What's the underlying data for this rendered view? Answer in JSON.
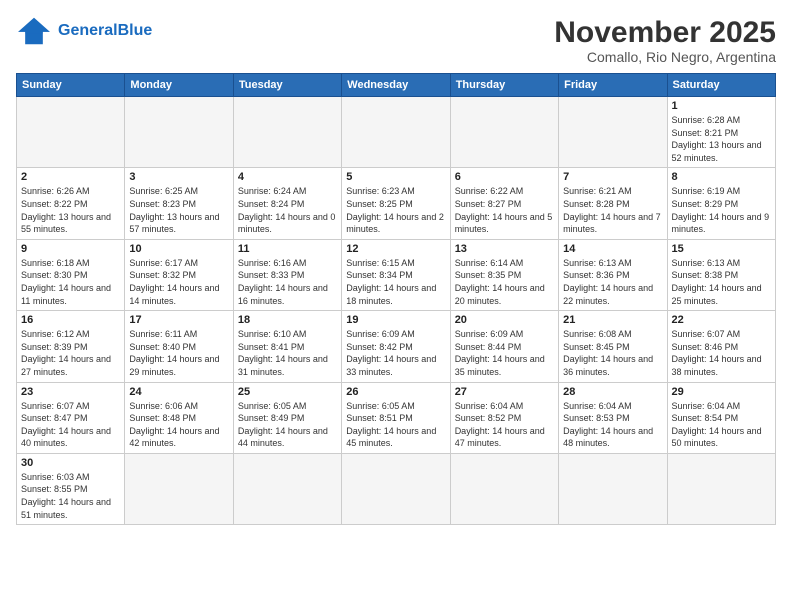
{
  "header": {
    "logo_general": "General",
    "logo_blue": "Blue",
    "title": "November 2025",
    "subtitle": "Comallo, Rio Negro, Argentina"
  },
  "days_of_week": [
    "Sunday",
    "Monday",
    "Tuesday",
    "Wednesday",
    "Thursday",
    "Friday",
    "Saturday"
  ],
  "weeks": [
    [
      {
        "day": "",
        "info": ""
      },
      {
        "day": "",
        "info": ""
      },
      {
        "day": "",
        "info": ""
      },
      {
        "day": "",
        "info": ""
      },
      {
        "day": "",
        "info": ""
      },
      {
        "day": "",
        "info": ""
      },
      {
        "day": "1",
        "info": "Sunrise: 6:28 AM\nSunset: 8:21 PM\nDaylight: 13 hours\nand 52 minutes."
      }
    ],
    [
      {
        "day": "2",
        "info": "Sunrise: 6:26 AM\nSunset: 8:22 PM\nDaylight: 13 hours\nand 55 minutes."
      },
      {
        "day": "3",
        "info": "Sunrise: 6:25 AM\nSunset: 8:23 PM\nDaylight: 13 hours\nand 57 minutes."
      },
      {
        "day": "4",
        "info": "Sunrise: 6:24 AM\nSunset: 8:24 PM\nDaylight: 14 hours\nand 0 minutes."
      },
      {
        "day": "5",
        "info": "Sunrise: 6:23 AM\nSunset: 8:25 PM\nDaylight: 14 hours\nand 2 minutes."
      },
      {
        "day": "6",
        "info": "Sunrise: 6:22 AM\nSunset: 8:27 PM\nDaylight: 14 hours\nand 5 minutes."
      },
      {
        "day": "7",
        "info": "Sunrise: 6:21 AM\nSunset: 8:28 PM\nDaylight: 14 hours\nand 7 minutes."
      },
      {
        "day": "8",
        "info": "Sunrise: 6:19 AM\nSunset: 8:29 PM\nDaylight: 14 hours\nand 9 minutes."
      }
    ],
    [
      {
        "day": "9",
        "info": "Sunrise: 6:18 AM\nSunset: 8:30 PM\nDaylight: 14 hours\nand 11 minutes."
      },
      {
        "day": "10",
        "info": "Sunrise: 6:17 AM\nSunset: 8:32 PM\nDaylight: 14 hours\nand 14 minutes."
      },
      {
        "day": "11",
        "info": "Sunrise: 6:16 AM\nSunset: 8:33 PM\nDaylight: 14 hours\nand 16 minutes."
      },
      {
        "day": "12",
        "info": "Sunrise: 6:15 AM\nSunset: 8:34 PM\nDaylight: 14 hours\nand 18 minutes."
      },
      {
        "day": "13",
        "info": "Sunrise: 6:14 AM\nSunset: 8:35 PM\nDaylight: 14 hours\nand 20 minutes."
      },
      {
        "day": "14",
        "info": "Sunrise: 6:13 AM\nSunset: 8:36 PM\nDaylight: 14 hours\nand 22 minutes."
      },
      {
        "day": "15",
        "info": "Sunrise: 6:13 AM\nSunset: 8:38 PM\nDaylight: 14 hours\nand 25 minutes."
      }
    ],
    [
      {
        "day": "16",
        "info": "Sunrise: 6:12 AM\nSunset: 8:39 PM\nDaylight: 14 hours\nand 27 minutes."
      },
      {
        "day": "17",
        "info": "Sunrise: 6:11 AM\nSunset: 8:40 PM\nDaylight: 14 hours\nand 29 minutes."
      },
      {
        "day": "18",
        "info": "Sunrise: 6:10 AM\nSunset: 8:41 PM\nDaylight: 14 hours\nand 31 minutes."
      },
      {
        "day": "19",
        "info": "Sunrise: 6:09 AM\nSunset: 8:42 PM\nDaylight: 14 hours\nand 33 minutes."
      },
      {
        "day": "20",
        "info": "Sunrise: 6:09 AM\nSunset: 8:44 PM\nDaylight: 14 hours\nand 35 minutes."
      },
      {
        "day": "21",
        "info": "Sunrise: 6:08 AM\nSunset: 8:45 PM\nDaylight: 14 hours\nand 36 minutes."
      },
      {
        "day": "22",
        "info": "Sunrise: 6:07 AM\nSunset: 8:46 PM\nDaylight: 14 hours\nand 38 minutes."
      }
    ],
    [
      {
        "day": "23",
        "info": "Sunrise: 6:07 AM\nSunset: 8:47 PM\nDaylight: 14 hours\nand 40 minutes."
      },
      {
        "day": "24",
        "info": "Sunrise: 6:06 AM\nSunset: 8:48 PM\nDaylight: 14 hours\nand 42 minutes."
      },
      {
        "day": "25",
        "info": "Sunrise: 6:05 AM\nSunset: 8:49 PM\nDaylight: 14 hours\nand 44 minutes."
      },
      {
        "day": "26",
        "info": "Sunrise: 6:05 AM\nSunset: 8:51 PM\nDaylight: 14 hours\nand 45 minutes."
      },
      {
        "day": "27",
        "info": "Sunrise: 6:04 AM\nSunset: 8:52 PM\nDaylight: 14 hours\nand 47 minutes."
      },
      {
        "day": "28",
        "info": "Sunrise: 6:04 AM\nSunset: 8:53 PM\nDaylight: 14 hours\nand 48 minutes."
      },
      {
        "day": "29",
        "info": "Sunrise: 6:04 AM\nSunset: 8:54 PM\nDaylight: 14 hours\nand 50 minutes."
      }
    ],
    [
      {
        "day": "30",
        "info": "Sunrise: 6:03 AM\nSunset: 8:55 PM\nDaylight: 14 hours\nand 51 minutes."
      },
      {
        "day": "",
        "info": ""
      },
      {
        "day": "",
        "info": ""
      },
      {
        "day": "",
        "info": ""
      },
      {
        "day": "",
        "info": ""
      },
      {
        "day": "",
        "info": ""
      },
      {
        "day": "",
        "info": ""
      }
    ]
  ]
}
